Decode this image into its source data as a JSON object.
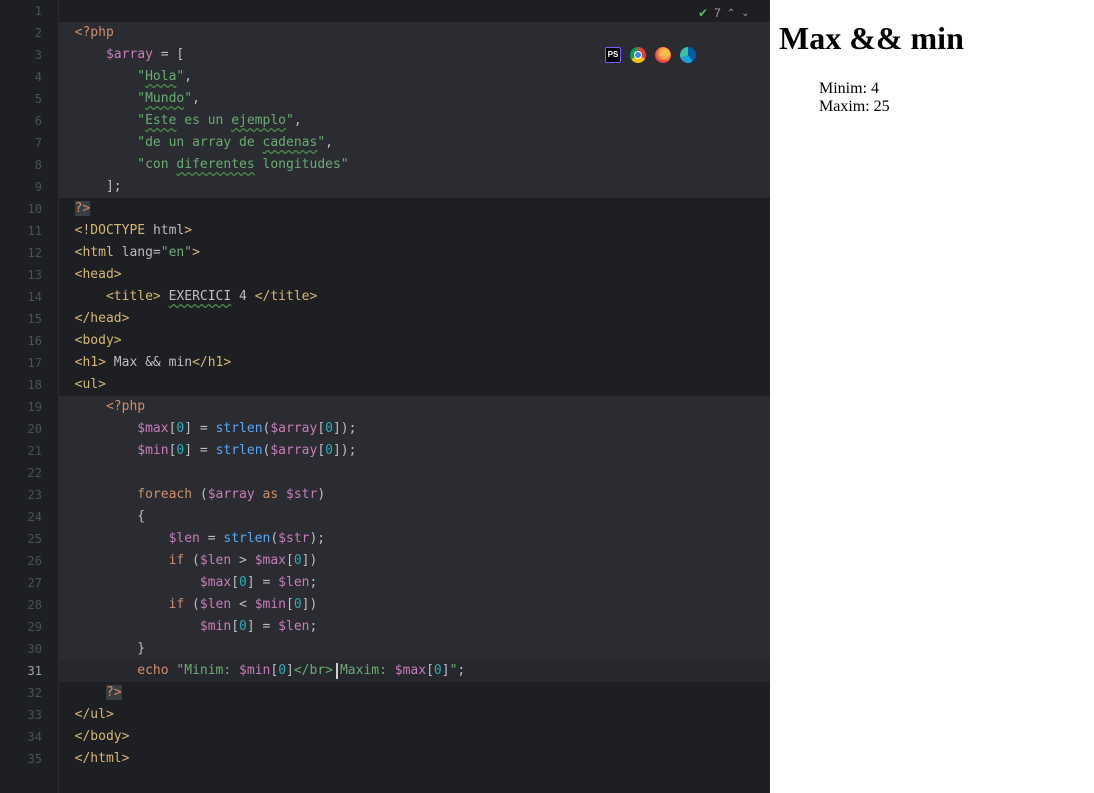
{
  "editor": {
    "inspection_count": "7",
    "line_numbers": [
      "1",
      "2",
      "3",
      "4",
      "5",
      "6",
      "7",
      "8",
      "9",
      "10",
      "11",
      "12",
      "13",
      "14",
      "15",
      "16",
      "17",
      "18",
      "19",
      "20",
      "21",
      "22",
      "23",
      "24",
      "25",
      "26",
      "27",
      "28",
      "29",
      "30",
      "31",
      "32",
      "33",
      "34",
      "35"
    ],
    "current_line": "31",
    "browser_icons": [
      "phpstorm-icon",
      "chrome-icon",
      "firefox-icon",
      "edge-icon"
    ],
    "code": {
      "l2": "<?php",
      "l3_var": "$array",
      "l3_rest": " = [",
      "l4": "\"Hola\"",
      "l5": "\"Mundo\"",
      "l6": "\"Este es un ejemplo\"",
      "l7": "\"de un array de cadenas\"",
      "l8": "\"con diferentes longitudes\"",
      "l9": "];",
      "l10": "?>",
      "l11": "<!DOCTYPE html>",
      "l12": "<html lang=\"en\">",
      "l13": "<head>",
      "l14": "<title> EXERCICI 4 </title>",
      "l15": "</head>",
      "l16": "<body>",
      "l17": "<h1> Max && min</h1>",
      "l18": "<ul>",
      "l19": "<?php",
      "l20": "$max[0] = strlen($array[0]);",
      "l21": "$min[0] = strlen($array[0]);",
      "l23": "foreach ($array as $str)",
      "l24": "{",
      "l25": "$len = strlen($str);",
      "l26": "if ($len > $max[0])",
      "l27": "$max[0] = $len;",
      "l28": "if ($len < $min[0])",
      "l29": "$min[0] = $len;",
      "l30": "}",
      "l31": "echo \"Minim: $min[0]</br> Maxim: $max[0]\";",
      "l32": "?>",
      "l33": "</ul>",
      "l34": "</body>",
      "l35": "</html>"
    }
  },
  "preview": {
    "heading": "Max && min",
    "minim": "Minim: 4",
    "maxim": "Maxim: 25"
  },
  "colors": {
    "editor_bg": "#1e1f22",
    "php_block_bg": "#2a2c31",
    "tag": "#d5b778",
    "keyword": "#cf8e6d",
    "variable": "#c77dbb",
    "string": "#6aab73",
    "number": "#2aacb8",
    "function": "#56a8f5"
  }
}
